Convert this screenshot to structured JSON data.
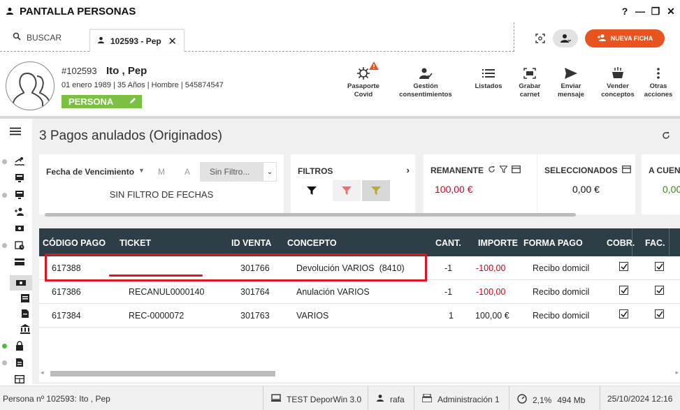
{
  "window": {
    "title": "PANTALLA PERSONAS",
    "controls": [
      "?",
      "—",
      "❐",
      "✕"
    ]
  },
  "tabs": {
    "search_label": "BUSCAR",
    "person_tab_label": "102593 - Pep",
    "new_button_label": "NUEVA FICHA"
  },
  "person": {
    "id": "#102593",
    "name": "Ito , Pep",
    "info": "01 enero 1989 | 35 Años | Hombre | 545874547",
    "badge": "PERSONA",
    "badge_color": "#7bc043"
  },
  "actions": [
    {
      "label": "Pasaporte\nCovid",
      "icon": "virus-icon"
    },
    {
      "label": "Gestión\nconsentimientos",
      "icon": "user-check-icon"
    },
    {
      "label": "Listados",
      "icon": "list-icon"
    },
    {
      "label": "Grabar\ncarnet",
      "icon": "card-record-icon"
    },
    {
      "label": "Enviar\nmensaje",
      "icon": "send-icon"
    },
    {
      "label": "Vender\nconceptos",
      "icon": "cart-icon"
    },
    {
      "label": "Otras\nacciones",
      "icon": "more-vertical-icon"
    }
  ],
  "main": {
    "heading": "3 Pagos anulados (Originados)"
  },
  "date_filter": {
    "label": "Fecha de Vencimiento",
    "m": "M",
    "a": "A",
    "selected": "Sin Filtro...",
    "summary": "SIN FILTRO DE FECHAS"
  },
  "filters": {
    "label": "FILTROS"
  },
  "kpis": {
    "remanente_label": "REMANENTE",
    "remanente_value": "100,00 €",
    "seleccionados_label": "SELECCIONADOS",
    "seleccionados_value": "0,00 €",
    "cuenta_label": "A CUEN",
    "cuenta_value": "0,00"
  },
  "table": {
    "columns": [
      "CÓDIGO PAGO",
      "TICKET",
      "ID VENTA",
      "CONCEPTO",
      "CANT.",
      "IMPORTE",
      "FORMA PAGO",
      "COBR.",
      "FAC."
    ],
    "rows": [
      {
        "codigo": "617388",
        "ticket": "",
        "id_venta": "301766",
        "concepto": "Devolución VARIOS  (8410)",
        "cant": "-1",
        "importe": "-100,00",
        "forma": "Recibo domicil",
        "cobr": true,
        "fac": true
      },
      {
        "codigo": "617386",
        "ticket": "RECANUL0000140",
        "id_venta": "301764",
        "concepto": "Anulación VARIOS",
        "cant": "-1",
        "importe": "-100,00",
        "forma": "Recibo domicil",
        "cobr": true,
        "fac": true
      },
      {
        "codigo": "617384",
        "ticket": "REC-0000072",
        "id_venta": "301763",
        "concepto": "VARIOS",
        "cant": "1",
        "importe": "100,00 €",
        "forma": "Recibo domicil",
        "cobr": true,
        "fac": true
      }
    ]
  },
  "status": {
    "persona": "Persona nº 102593: Ito , Pep",
    "server": "TEST DeporWin 3.0",
    "user": "rafa",
    "admin": "Administración 1",
    "cpu": "2,1%",
    "mem": "494 Mb",
    "datetime": "25/10/2024 12:16"
  },
  "colors": {
    "accent": "#e8541f",
    "table_header": "#2e3e47",
    "negative": "#d0021b",
    "highlight": "#e0141e"
  }
}
